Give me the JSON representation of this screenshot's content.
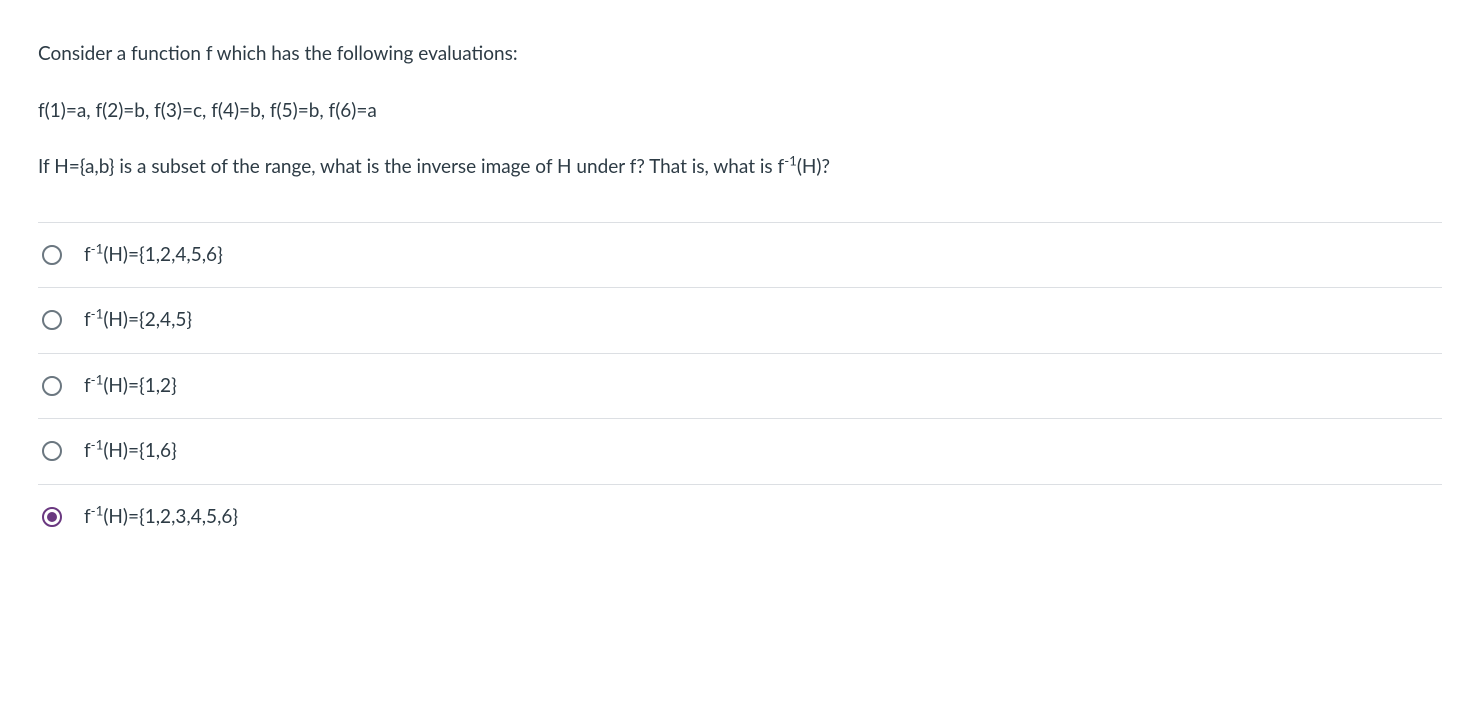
{
  "question": {
    "line1": "Consider a function f which has the following evaluations:",
    "line2": "f(1)=a, f(2)=b, f(3)=c, f(4)=b, f(5)=b, f(6)=a",
    "line3_html": "If H={a,b} is a subset of the range, what is the inverse image of H under f? That is, what is f<sup>-1</sup>(H)?"
  },
  "answers": [
    {
      "label_html": "f<sup>-1</sup>(H)={1,2,4,5,6}",
      "selected": false
    },
    {
      "label_html": "f<sup>-1</sup>(H)={2,4,5}",
      "selected": false
    },
    {
      "label_html": "f<sup>-1</sup>(H)={1,2}",
      "selected": false
    },
    {
      "label_html": "f<sup>-1</sup>(H)={1,6}",
      "selected": false
    },
    {
      "label_html": "f<sup>-1</sup>(H)={1,2,3,4,5,6}",
      "selected": true
    }
  ]
}
